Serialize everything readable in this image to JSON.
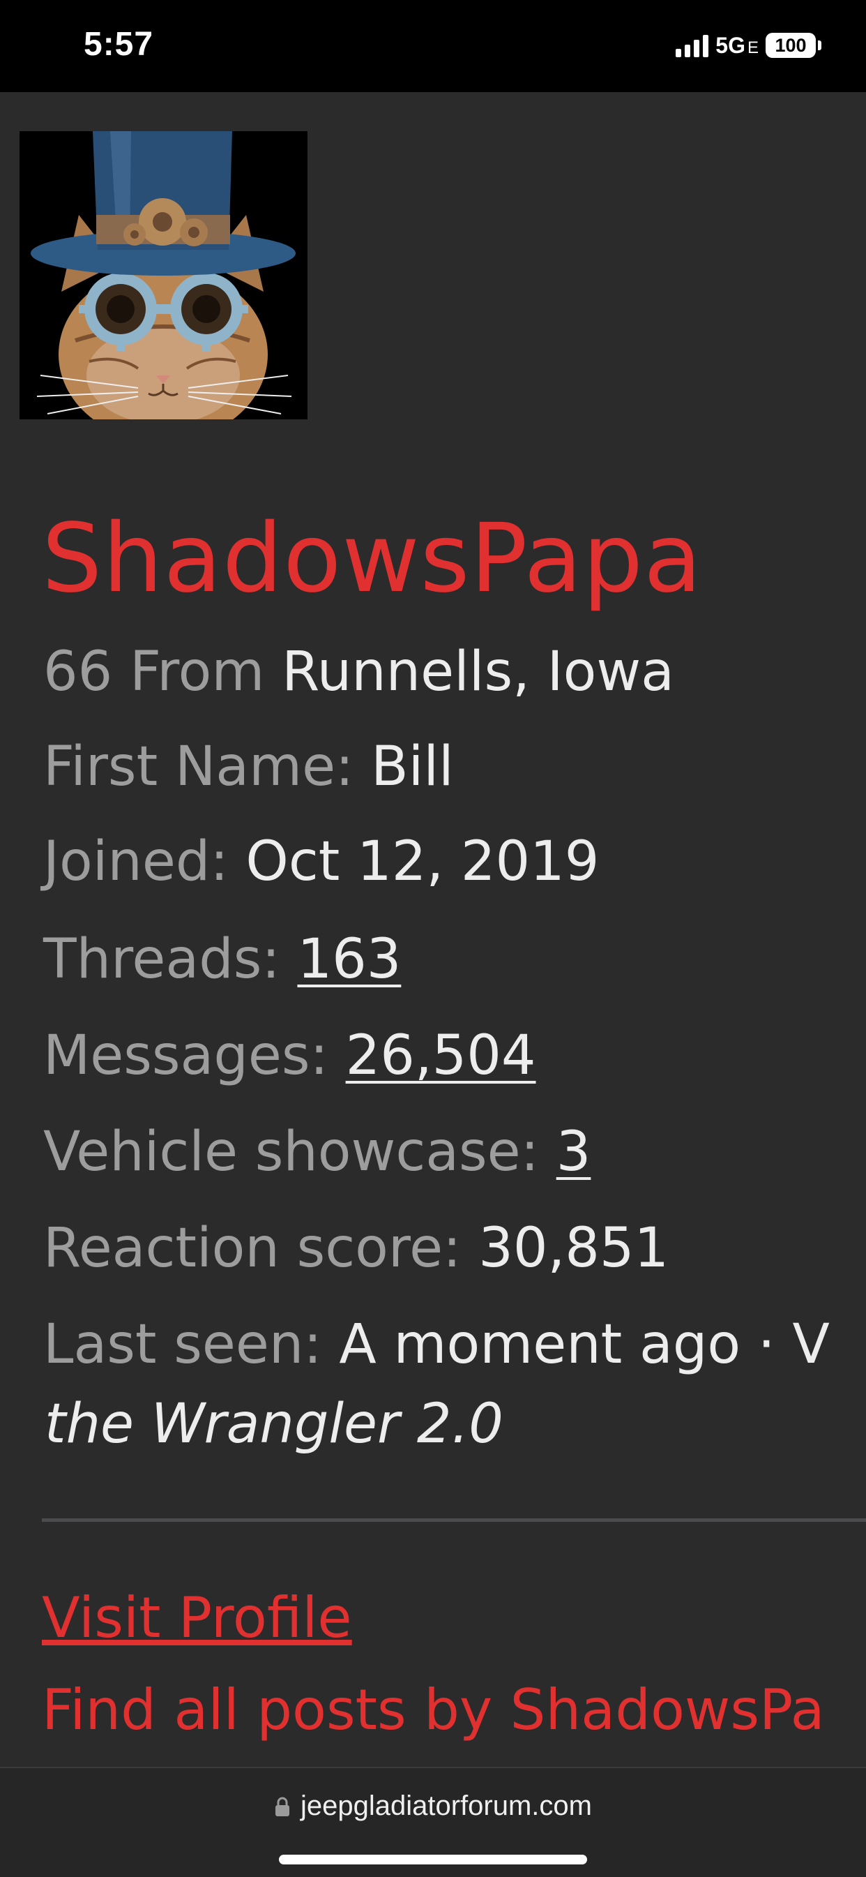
{
  "status_bar": {
    "time": "5:57",
    "network": "5G",
    "network_suffix": "E",
    "battery": "100"
  },
  "profile": {
    "username": "ShadowsPapa",
    "age": "66",
    "from_label": "From",
    "location": "Runnells, Iowa",
    "first_name_label": "First Name:",
    "first_name": "Bill",
    "joined_label": "Joined:",
    "joined": "Oct 12, 2019",
    "threads_label": "Threads:",
    "threads": "163",
    "messages_label": "Messages:",
    "messages": "26,504",
    "showcase_label": "Vehicle showcase:",
    "showcase": "3",
    "reaction_label": "Reaction score:",
    "reaction": "30,851",
    "last_seen_label": "Last seen:",
    "last_seen": "A moment ago · V",
    "last_seen_continued": "the Wrangler 2.0"
  },
  "actions": {
    "visit_profile": "Visit Profile",
    "find_posts": "Find all posts by ShadowsPa"
  },
  "browser": {
    "url": "jeepgladiatorforum.com"
  },
  "colors": {
    "accent": "#e0302f",
    "background": "#2b2b2c",
    "label": "#9d9d9d",
    "value": "#ededed"
  }
}
